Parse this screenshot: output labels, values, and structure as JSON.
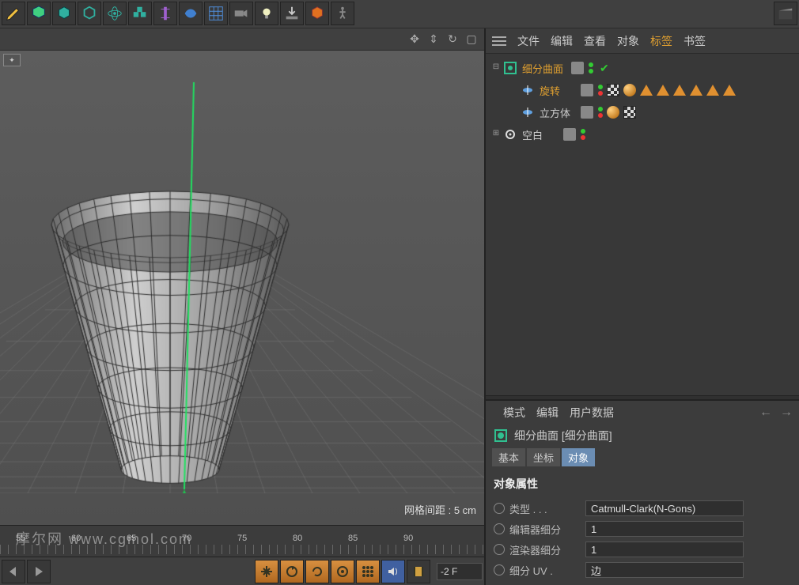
{
  "toolbar_icons": [
    "pen",
    "cube-green",
    "cube-teal-1",
    "cube-teal-2",
    "atom",
    "cubes",
    "bar-purple",
    "lens-blue",
    "grid-blue",
    "camera-dual",
    "bulb",
    "download-arrow",
    "cube-orange",
    "figure",
    "clapper"
  ],
  "viewport": {
    "grid_label": "网格间距 : 5 cm",
    "nav_icons": [
      "move",
      "zoom",
      "rotate",
      "frame"
    ],
    "camera_badge": "✦"
  },
  "timeline": {
    "marks": [
      55,
      60,
      65,
      70,
      75,
      80,
      85,
      90
    ],
    "current_frame": "-2 F"
  },
  "controls_icons": [
    "prev",
    "play",
    "move-orange",
    "rotate-orange",
    "loop-orange",
    "target-orange",
    "grid-orange",
    "speaker",
    "film"
  ],
  "watermark": "摩尔网 www.cgmol.com",
  "om_menu": {
    "items": [
      "文件",
      "编辑",
      "查看",
      "对象",
      "标签",
      "书签"
    ],
    "active_index": 4
  },
  "tree": [
    {
      "indent": 0,
      "exp": "⊟",
      "icon": "subdiv",
      "label": "细分曲面",
      "sel": true,
      "dots": [
        "g",
        "g"
      ],
      "check": true
    },
    {
      "indent": 1,
      "exp": "",
      "icon": "lathe",
      "label": "旋转",
      "sel": true,
      "dots": [
        "g",
        "r"
      ],
      "tags": [
        "checker",
        "ball",
        "tri",
        "tri",
        "tri",
        "tri",
        "tri",
        "tri"
      ]
    },
    {
      "indent": 1,
      "exp": "",
      "icon": "lathe",
      "label": "立方体",
      "sel": false,
      "dots": [
        "g",
        "r"
      ],
      "tags": [
        "ball",
        "checker"
      ]
    },
    {
      "indent": 0,
      "exp": "⊞",
      "icon": "null",
      "label": "空白",
      "sel": false,
      "dots": [
        "g",
        "r"
      ]
    }
  ],
  "attr_menu": [
    "模式",
    "编辑",
    "用户数据"
  ],
  "attr_head": "细分曲面 [细分曲面]",
  "attr_tabs": [
    "基本",
    "坐标",
    "对象"
  ],
  "attr_tab_sel": 2,
  "attr_section_title": "对象属性",
  "props": [
    {
      "label": "类型 . . .",
      "value": "Catmull-Clark(N-Gons)"
    },
    {
      "label": "编辑器细分",
      "value": "1"
    },
    {
      "label": "渲染器细分",
      "value": "1"
    },
    {
      "label": "细分 UV .",
      "value": "边"
    }
  ]
}
